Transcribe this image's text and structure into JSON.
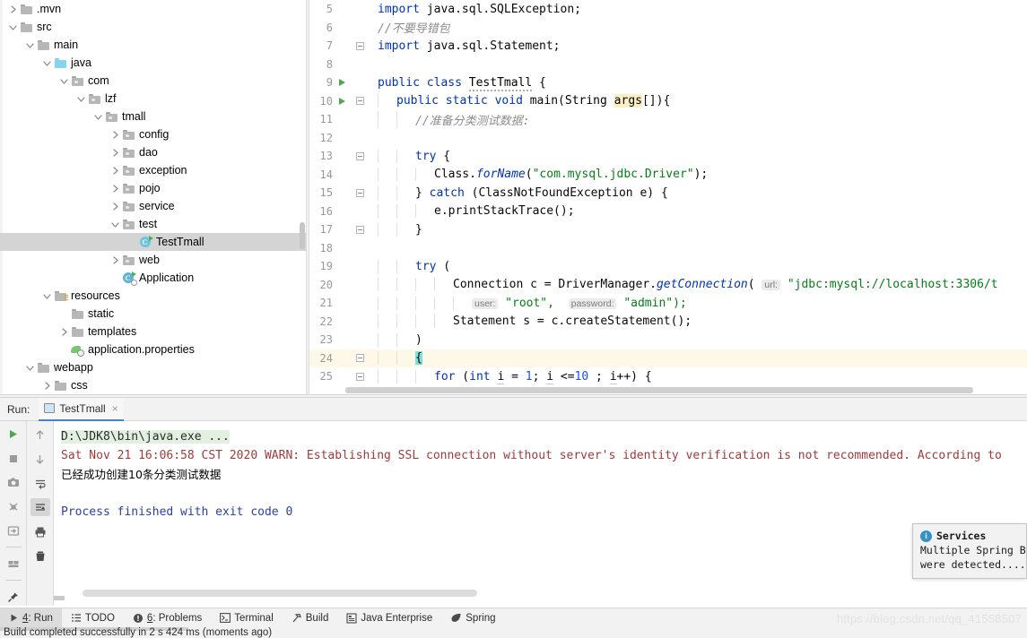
{
  "project_tree": {
    "items": [
      {
        "label": ".mvn",
        "depth": 1,
        "arrow": "right",
        "icon": "folder"
      },
      {
        "label": "src",
        "depth": 1,
        "arrow": "down",
        "icon": "folder"
      },
      {
        "label": "main",
        "depth": 2,
        "arrow": "down",
        "icon": "folder"
      },
      {
        "label": "java",
        "depth": 3,
        "arrow": "down",
        "icon": "folder-blue"
      },
      {
        "label": "com",
        "depth": 4,
        "arrow": "down",
        "icon": "folder-pkg"
      },
      {
        "label": "lzf",
        "depth": 5,
        "arrow": "down",
        "icon": "folder-pkg"
      },
      {
        "label": "tmall",
        "depth": 6,
        "arrow": "down",
        "icon": "folder-pkg"
      },
      {
        "label": "config",
        "depth": 7,
        "arrow": "right",
        "icon": "folder-pkg"
      },
      {
        "label": "dao",
        "depth": 7,
        "arrow": "right",
        "icon": "folder-pkg"
      },
      {
        "label": "exception",
        "depth": 7,
        "arrow": "right",
        "icon": "folder-pkg"
      },
      {
        "label": "pojo",
        "depth": 7,
        "arrow": "right",
        "icon": "folder-pkg"
      },
      {
        "label": "service",
        "depth": 7,
        "arrow": "right",
        "icon": "folder-pkg"
      },
      {
        "label": "test",
        "depth": 7,
        "arrow": "down",
        "icon": "folder-pkg"
      },
      {
        "label": "TestTmall",
        "depth": 8,
        "arrow": "none",
        "icon": "class",
        "selected": true
      },
      {
        "label": "web",
        "depth": 7,
        "arrow": "right",
        "icon": "folder-pkg"
      },
      {
        "label": "Application",
        "depth": 7,
        "arrow": "none",
        "icon": "class-spring"
      },
      {
        "label": "resources",
        "depth": 3,
        "arrow": "down",
        "icon": "folder-res"
      },
      {
        "label": "static",
        "depth": 4,
        "arrow": "none",
        "icon": "folder"
      },
      {
        "label": "templates",
        "depth": 4,
        "arrow": "right",
        "icon": "folder"
      },
      {
        "label": "application.properties",
        "depth": 4,
        "arrow": "none",
        "icon": "properties"
      },
      {
        "label": "webapp",
        "depth": 2,
        "arrow": "down",
        "icon": "folder"
      },
      {
        "label": "css",
        "depth": 3,
        "arrow": "right",
        "icon": "folder"
      }
    ]
  },
  "editor": {
    "lines": [
      {
        "num": "5",
        "indent": 0,
        "run": false,
        "fold": "none",
        "type": "import",
        "text": "import java.sql.SQLException;"
      },
      {
        "num": "6",
        "indent": 0,
        "run": false,
        "fold": "none",
        "type": "comment",
        "text": "//不要导错包"
      },
      {
        "num": "7",
        "indent": 0,
        "run": false,
        "fold": "tri",
        "type": "import",
        "text": "import java.sql.Statement;"
      },
      {
        "num": "8",
        "indent": 0,
        "run": false,
        "fold": "none",
        "type": "blank",
        "text": ""
      },
      {
        "num": "9",
        "indent": 0,
        "run": true,
        "fold": "none",
        "type": "classdecl",
        "text": "public class TestTmall {"
      },
      {
        "num": "10",
        "indent": 1,
        "run": true,
        "fold": "box",
        "type": "maindecl",
        "text": "public static void main(String args[]){"
      },
      {
        "num": "11",
        "indent": 2,
        "run": false,
        "fold": "line",
        "type": "comment",
        "text": "//准备分类测试数据:"
      },
      {
        "num": "12",
        "indent": 0,
        "run": false,
        "fold": "line",
        "type": "blank",
        "text": ""
      },
      {
        "num": "13",
        "indent": 2,
        "run": false,
        "fold": "box",
        "type": "try",
        "text": "try {"
      },
      {
        "num": "14",
        "indent": 3,
        "run": false,
        "fold": "line",
        "type": "forname",
        "text": "Class.forName(\"com.mysql.jdbc.Driver\");"
      },
      {
        "num": "15",
        "indent": 2,
        "run": false,
        "fold": "box",
        "type": "catch",
        "text": "} catch (ClassNotFoundException e) {"
      },
      {
        "num": "16",
        "indent": 3,
        "run": false,
        "fold": "line",
        "type": "plain",
        "text": "e.printStackTrace();"
      },
      {
        "num": "17",
        "indent": 2,
        "run": false,
        "fold": "box",
        "type": "plain",
        "text": "}"
      },
      {
        "num": "18",
        "indent": 0,
        "run": false,
        "fold": "none",
        "type": "blank",
        "text": ""
      },
      {
        "num": "19",
        "indent": 2,
        "run": false,
        "fold": "none",
        "type": "trypar",
        "text": "try ("
      },
      {
        "num": "20",
        "indent": 4,
        "run": false,
        "fold": "line",
        "type": "conn",
        "text": "Connection c = DriverManager.getConnection( url: \"jdbc:mysql://localhost:3306/t"
      },
      {
        "num": "21",
        "indent": 5,
        "run": false,
        "fold": "line",
        "type": "userpass",
        "text": "user: \"root\",  password: \"admin\");"
      },
      {
        "num": "22",
        "indent": 4,
        "run": false,
        "fold": "line",
        "type": "stmt",
        "text": "Statement s = c.createStatement();"
      },
      {
        "num": "23",
        "indent": 2,
        "run": false,
        "fold": "line",
        "type": "plain",
        "text": ")"
      },
      {
        "num": "24",
        "indent": 2,
        "run": false,
        "fold": "box",
        "type": "brace",
        "text": "{",
        "highlight": true
      },
      {
        "num": "25",
        "indent": 3,
        "run": false,
        "fold": "box",
        "type": "forloop",
        "text": "for (int i = 1; i <=10 ; i++) {"
      }
    ],
    "tokens": {
      "import_kw": "import",
      "import5": " java.sql.SQLException;",
      "import7": " java.sql.Statement;",
      "comment6": "//不要导错包",
      "comment11": "//准备分类测试数据:",
      "public": "public",
      "class": "class",
      "classname": "TestTmall",
      "brace_open": " {",
      "static": "static",
      "void": "void",
      "main": "main",
      "string_type": "String",
      "args": "args",
      "args_tail": "[]){",
      "try": "try",
      "catch": "catch",
      "class_ref": "Class.",
      "forname": "forName",
      "driver_str": "\"com.mysql.jdbc.Driver\"",
      "cnfe": "(ClassNotFoundException e) {",
      "printstack": "e.printStackTrace();",
      "close_brace": "}",
      "try_paren": "try (",
      "connection": "Connection c = DriverManager.",
      "getconnection": "getConnection",
      "url_hint": "url:",
      "url_value": "\"jdbc:mysql://localhost:3306/t",
      "user_hint": "user:",
      "user_value": "\"root\",",
      "password_hint": "password:",
      "password_value": "\"admin\");",
      "statement": "Statement s = c.createStatement();",
      "close_paren": ")",
      "open_brace": "{",
      "for_kw": "for",
      "for_rest_a": " (",
      "int_kw": "int",
      "for_i1": "i",
      "for_eq": " = ",
      "for_one": "1",
      "for_semi": "; ",
      "for_i2": "i",
      "for_lte": " <=",
      "for_ten": "10",
      "for_tail": " ; ",
      "for_i3": "i",
      "for_end": "++) {"
    }
  },
  "run_panel": {
    "label": "Run:",
    "tab_name": "TestTmall",
    "close_glyph": "×",
    "console": [
      {
        "text": "D:\\JDK8\\bin\\java.exe ...",
        "style": "cmd"
      },
      {
        "text": "Sat Nov 21 16:06:58 CST 2020 WARN: Establishing SSL connection without server's identity verification is not recommended. According to",
        "style": "warn"
      },
      {
        "text": "已经成功创建10条分类测试数据",
        "style": "cn"
      },
      {
        "text": "",
        "style": "blank"
      },
      {
        "text": "Process finished with exit code 0",
        "style": "done"
      }
    ],
    "tools_col1": [
      "run-icon",
      "stop-icon",
      "camera-icon",
      "debug-icon",
      "export-icon",
      "layout-icon",
      "pin-icon"
    ],
    "tools_col2": [
      "arrow-up-icon",
      "arrow-down-icon",
      "soft-wrap-icon",
      "scroll-end-icon",
      "print-icon",
      "trash-icon"
    ]
  },
  "services_balloon": {
    "icon_glyph": "i",
    "title": "Services",
    "body_line1": "Multiple Spring B",
    "body_line2": "were detected...."
  },
  "bottom_bar": {
    "items": [
      {
        "label": "4: Run",
        "num": "4",
        "rest": ": Run",
        "icon": "run-icon",
        "active": true
      },
      {
        "label": "TODO",
        "num": "",
        "rest": "TODO",
        "icon": "todo-icon",
        "active": false
      },
      {
        "label": "6: Problems",
        "num": "6",
        "rest": ": Problems",
        "icon": "problems-icon",
        "active": false
      },
      {
        "label": "Terminal",
        "num": "",
        "rest": "Terminal",
        "icon": "terminal-icon",
        "active": false
      },
      {
        "label": "Build",
        "num": "",
        "rest": "Build",
        "icon": "build-icon",
        "active": false
      },
      {
        "label": "Java Enterprise",
        "num": "",
        "rest": "Java Enterprise",
        "icon": "java-ee-icon",
        "active": false
      },
      {
        "label": "Spring",
        "num": "",
        "rest": "Spring",
        "icon": "spring-icon",
        "active": false
      }
    ]
  },
  "watermark": {
    "text": "https://blog.csdn.net/qq_41558507"
  },
  "status_bar": {
    "text": "Build completed successfully in 2 s 424 ms (moments ago)"
  }
}
